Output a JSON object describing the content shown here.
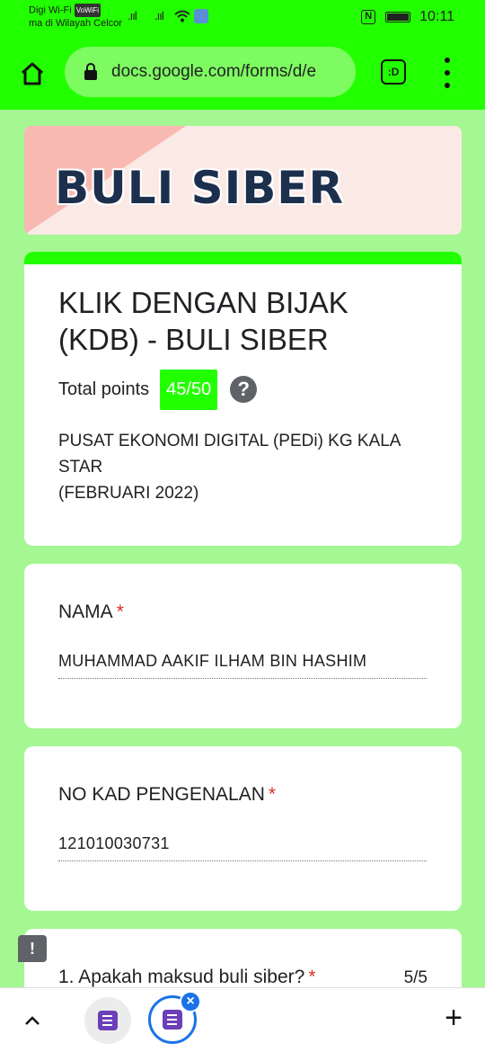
{
  "status_bar": {
    "carrier_line1": "Digi Wi-Fi",
    "wifi_badge": "VoWiFi",
    "carrier_line2": "ma di Wilayah Celcor",
    "signal1": ".ııl",
    "signal2": ".ııl",
    "nfc": "N",
    "time": "10:11"
  },
  "browser": {
    "url": "docs.google.com/forms/d/e",
    "tab_switcher_label": ":D"
  },
  "banner": {
    "title": "BULI SIBER"
  },
  "form": {
    "title": "KLIK DENGAN BIJAK (KDB) - BULI SIBER",
    "points_label": "Total points",
    "points_value": "45/50",
    "help_glyph": "?",
    "description_line1": "PUSAT EKONOMI DIGITAL (PEDi) KG KALA STAR",
    "description_line2": "(FEBRUARI 2022)"
  },
  "questions": [
    {
      "title": "NAMA",
      "required_mark": "*",
      "answer": "MUHAMMAD AAKIF ILHAM BIN HASHIM"
    },
    {
      "title": "NO KAD PENGENALAN",
      "required_mark": "*",
      "answer": "121010030731"
    },
    {
      "title": "1. Apakah maksud buli siber?",
      "required_mark": "*",
      "score": "5/5"
    }
  ],
  "feedback_glyph": "!",
  "bottom_bar": {
    "plus_glyph": "+",
    "close_glyph": "×"
  },
  "colors": {
    "accent_green": "#22ff00",
    "page_background": "#a4f792",
    "required_red": "#d93025"
  }
}
